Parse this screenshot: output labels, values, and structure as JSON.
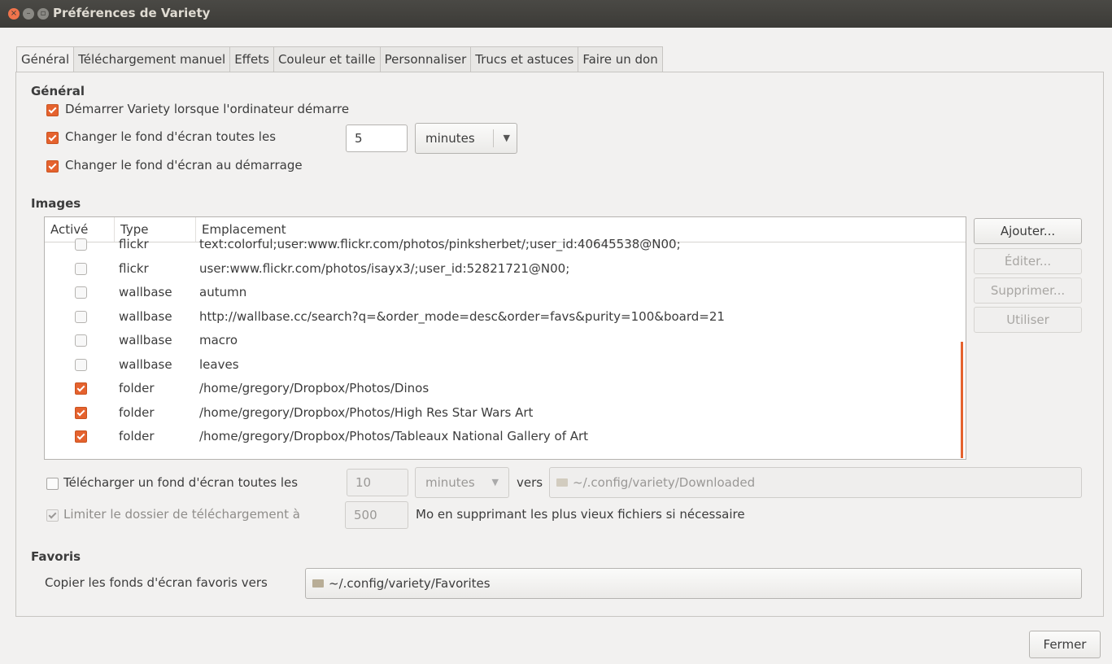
{
  "window": {
    "title": "Préférences de Variety",
    "close_glyph": "×",
    "minimize_glyph": "–",
    "maximize_glyph": "▫"
  },
  "tabs": [
    {
      "label": "Général",
      "active": true
    },
    {
      "label": "Téléchargement manuel"
    },
    {
      "label": "Effets"
    },
    {
      "label": "Couleur et taille"
    },
    {
      "label": "Personnaliser"
    },
    {
      "label": "Trucs et astuces"
    },
    {
      "label": "Faire un don"
    }
  ],
  "general": {
    "heading": "Général",
    "start_on_boot": {
      "label": "Démarrer Variety lorsque l'ordinateur démarre",
      "checked": true
    },
    "change_every": {
      "label": "Changer le fond d'écran toutes les",
      "checked": true,
      "value": "5",
      "unit": "minutes"
    },
    "change_on_start": {
      "label": "Changer le fond d'écran au démarrage",
      "checked": true
    }
  },
  "images": {
    "heading": "Images",
    "columns": [
      "Activé",
      "Type",
      "Emplacement"
    ],
    "rows": [
      {
        "enabled": false,
        "type": "flickr",
        "location": "text:colorful;user:www.flickr.com/photos/pinksherbet/;user_id:40645538@N00;"
      },
      {
        "enabled": false,
        "type": "flickr",
        "location": "user:www.flickr.com/photos/isayx3/;user_id:52821721@N00;"
      },
      {
        "enabled": false,
        "type": "wallbase",
        "location": "autumn"
      },
      {
        "enabled": false,
        "type": "wallbase",
        "location": "http://wallbase.cc/search?q=&order_mode=desc&order=favs&purity=100&board=21"
      },
      {
        "enabled": false,
        "type": "wallbase",
        "location": "macro"
      },
      {
        "enabled": false,
        "type": "wallbase",
        "location": "leaves"
      },
      {
        "enabled": true,
        "type": "folder",
        "location": "/home/gregory/Dropbox/Photos/Dinos"
      },
      {
        "enabled": true,
        "type": "folder",
        "location": "/home/gregory/Dropbox/Photos/High Res Star Wars Art"
      },
      {
        "enabled": true,
        "type": "folder",
        "location": "/home/gregory/Dropbox/Photos/Tableaux National Gallery of Art"
      }
    ],
    "buttons": {
      "add": "Ajouter...",
      "edit": "Éditer...",
      "remove": "Supprimer...",
      "use": "Utiliser"
    }
  },
  "download": {
    "label": "Télécharger un fond d'écran toutes les",
    "checked": false,
    "value": "10",
    "unit": "minutes",
    "to_label": "vers",
    "folder": "~/.config/variety/Downloaded",
    "limit_label": "Limiter le dossier de téléchargement à",
    "limit_checked": true,
    "limit_value": "500",
    "limit_suffix": "Mo en supprimant les plus vieux fichiers si nécessaire"
  },
  "favorites": {
    "heading": "Favoris",
    "label": "Copier les fonds d'écran favoris vers",
    "folder": "~/.config/variety/Favorites"
  },
  "footer": {
    "close_label": "Fermer"
  },
  "colors": {
    "accent": "#e5622e",
    "titlebar": "#3c3b37"
  }
}
